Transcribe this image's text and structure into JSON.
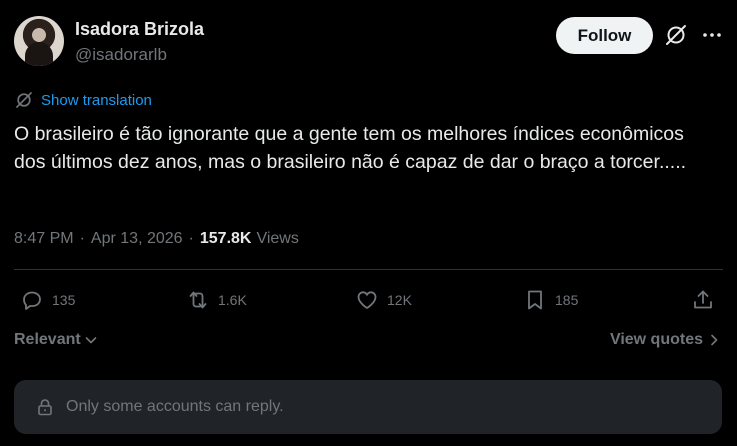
{
  "author": {
    "name": "Isadora Brizola",
    "handle": "@isadorarlb"
  },
  "header": {
    "follow_label": "Follow",
    "grok_icon": "grok-icon",
    "more_icon": "more-icon"
  },
  "translation": {
    "label": "Show translation",
    "icon": "grok-icon"
  },
  "tweet": {
    "text": "O brasileiro é tão ignorante que a gente tem os melhores índices econômicos dos últimos dez anos, mas o brasileiro não é capaz de dar o braço a torcer.....",
    "time": "8:47 PM",
    "separator": "·",
    "date": "Apr 13, 2026",
    "views_count": "157.8K",
    "views_label": "Views"
  },
  "actions": {
    "replies": "135",
    "reposts": "1.6K",
    "likes": "12K",
    "bookmarks": "185"
  },
  "replies_section": {
    "sort_label": "Relevant",
    "quotes_label": "View quotes",
    "restriction_text": "Only some accounts can reply."
  },
  "colors": {
    "background": "#000000",
    "text": "#e7e9ea",
    "muted": "#71767b",
    "link": "#1d9bf0",
    "follow_bg": "#eff3f4",
    "reply_box_bg": "#202327",
    "divider": "#2f3336"
  }
}
